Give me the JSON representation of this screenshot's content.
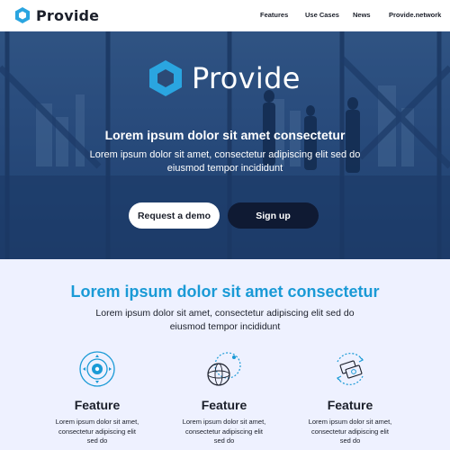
{
  "header": {
    "brand": "Provide",
    "nav": [
      "Features",
      "Use Cases",
      "News",
      "Provide.network"
    ]
  },
  "hero": {
    "logo_text": "Provide",
    "title": "Lorem ipsum dolor sit amet consectetur",
    "subtitle": "Lorem ipsum dolor sit amet, consectetur adipiscing elit sed do eiusmod tempor incididunt",
    "buttons": {
      "demo": "Request a demo",
      "signup": "Sign up"
    }
  },
  "section": {
    "title": "Lorem ipsum dolor sit amet consectetur",
    "subtitle": "Lorem ipsum dolor sit amet, consectetur adipiscing elit sed do eiusmod tempor incididunt"
  },
  "features": [
    {
      "icon": "target-icon",
      "title": "Feature",
      "desc": "Lorem ipsum dolor sit amet, consectetur adipiscing elit sed do"
    },
    {
      "icon": "sphere-orbit-icon",
      "title": "Feature",
      "desc": "Lorem ipsum dolor sit amet, consectetur adipiscing elit sed do"
    },
    {
      "icon": "money-exchange-icon",
      "title": "Feature",
      "desc": "Lorem ipsum dolor sit amet, consectetur adipiscing elit sed do"
    }
  ],
  "colors": {
    "accent": "#1a9ad6",
    "hero_overlay": "#2c4a76",
    "dark_button": "#0f1a33",
    "section_bg": "#eef1ff"
  }
}
